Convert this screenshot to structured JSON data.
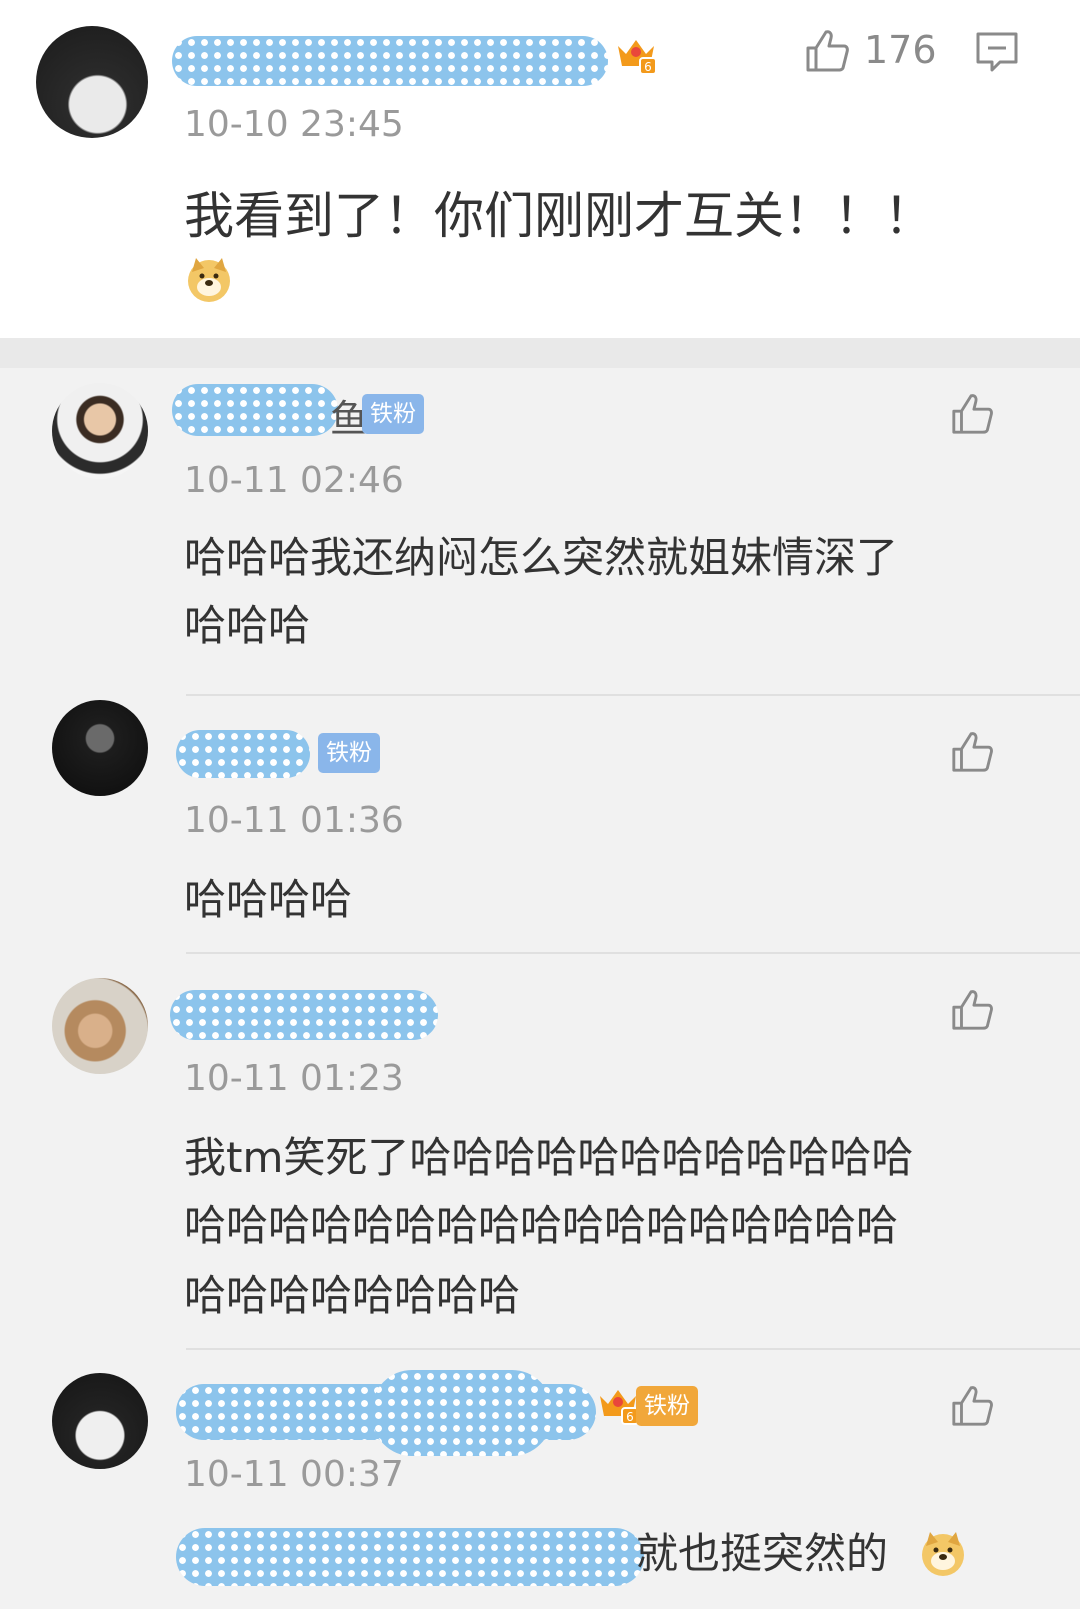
{
  "main_comment": {
    "time": "10-10 23:45",
    "like_count": "176",
    "text": "我看到了！你们刚刚才互关！！！"
  },
  "replies": [
    {
      "time": "10-11 02:46",
      "badge": "铁粉",
      "name_tail": "鱼",
      "text_lines": [
        "哈哈哈我还纳闷怎么突然就姐妹情深了",
        "哈哈哈"
      ]
    },
    {
      "time": "10-11 01:36",
      "badge": "铁粉",
      "text_lines": [
        "哈哈哈哈"
      ]
    },
    {
      "time": "10-11 01:23",
      "text_lines": [
        "我tm笑死了哈哈哈哈哈哈哈哈哈哈哈哈",
        "哈哈哈哈哈哈哈哈哈哈哈哈哈哈哈哈哈",
        "哈哈哈哈哈哈哈哈"
      ]
    },
    {
      "time": "10-11 00:37",
      "badge": "铁粉",
      "text_tail": "就也挺突然的"
    }
  ],
  "colors": {
    "blur_blue": "#8cc4ec",
    "fan_badge_blue": "#8ab6ea",
    "fan_badge_gold": "#f1a73a",
    "crown_orange": "#f39a1b",
    "timestamp_gray": "#9a9a9a"
  },
  "icons": [
    "thumbs-up-icon",
    "comment-icon",
    "crown-level-6-icon",
    "doge-emoji-icon"
  ]
}
